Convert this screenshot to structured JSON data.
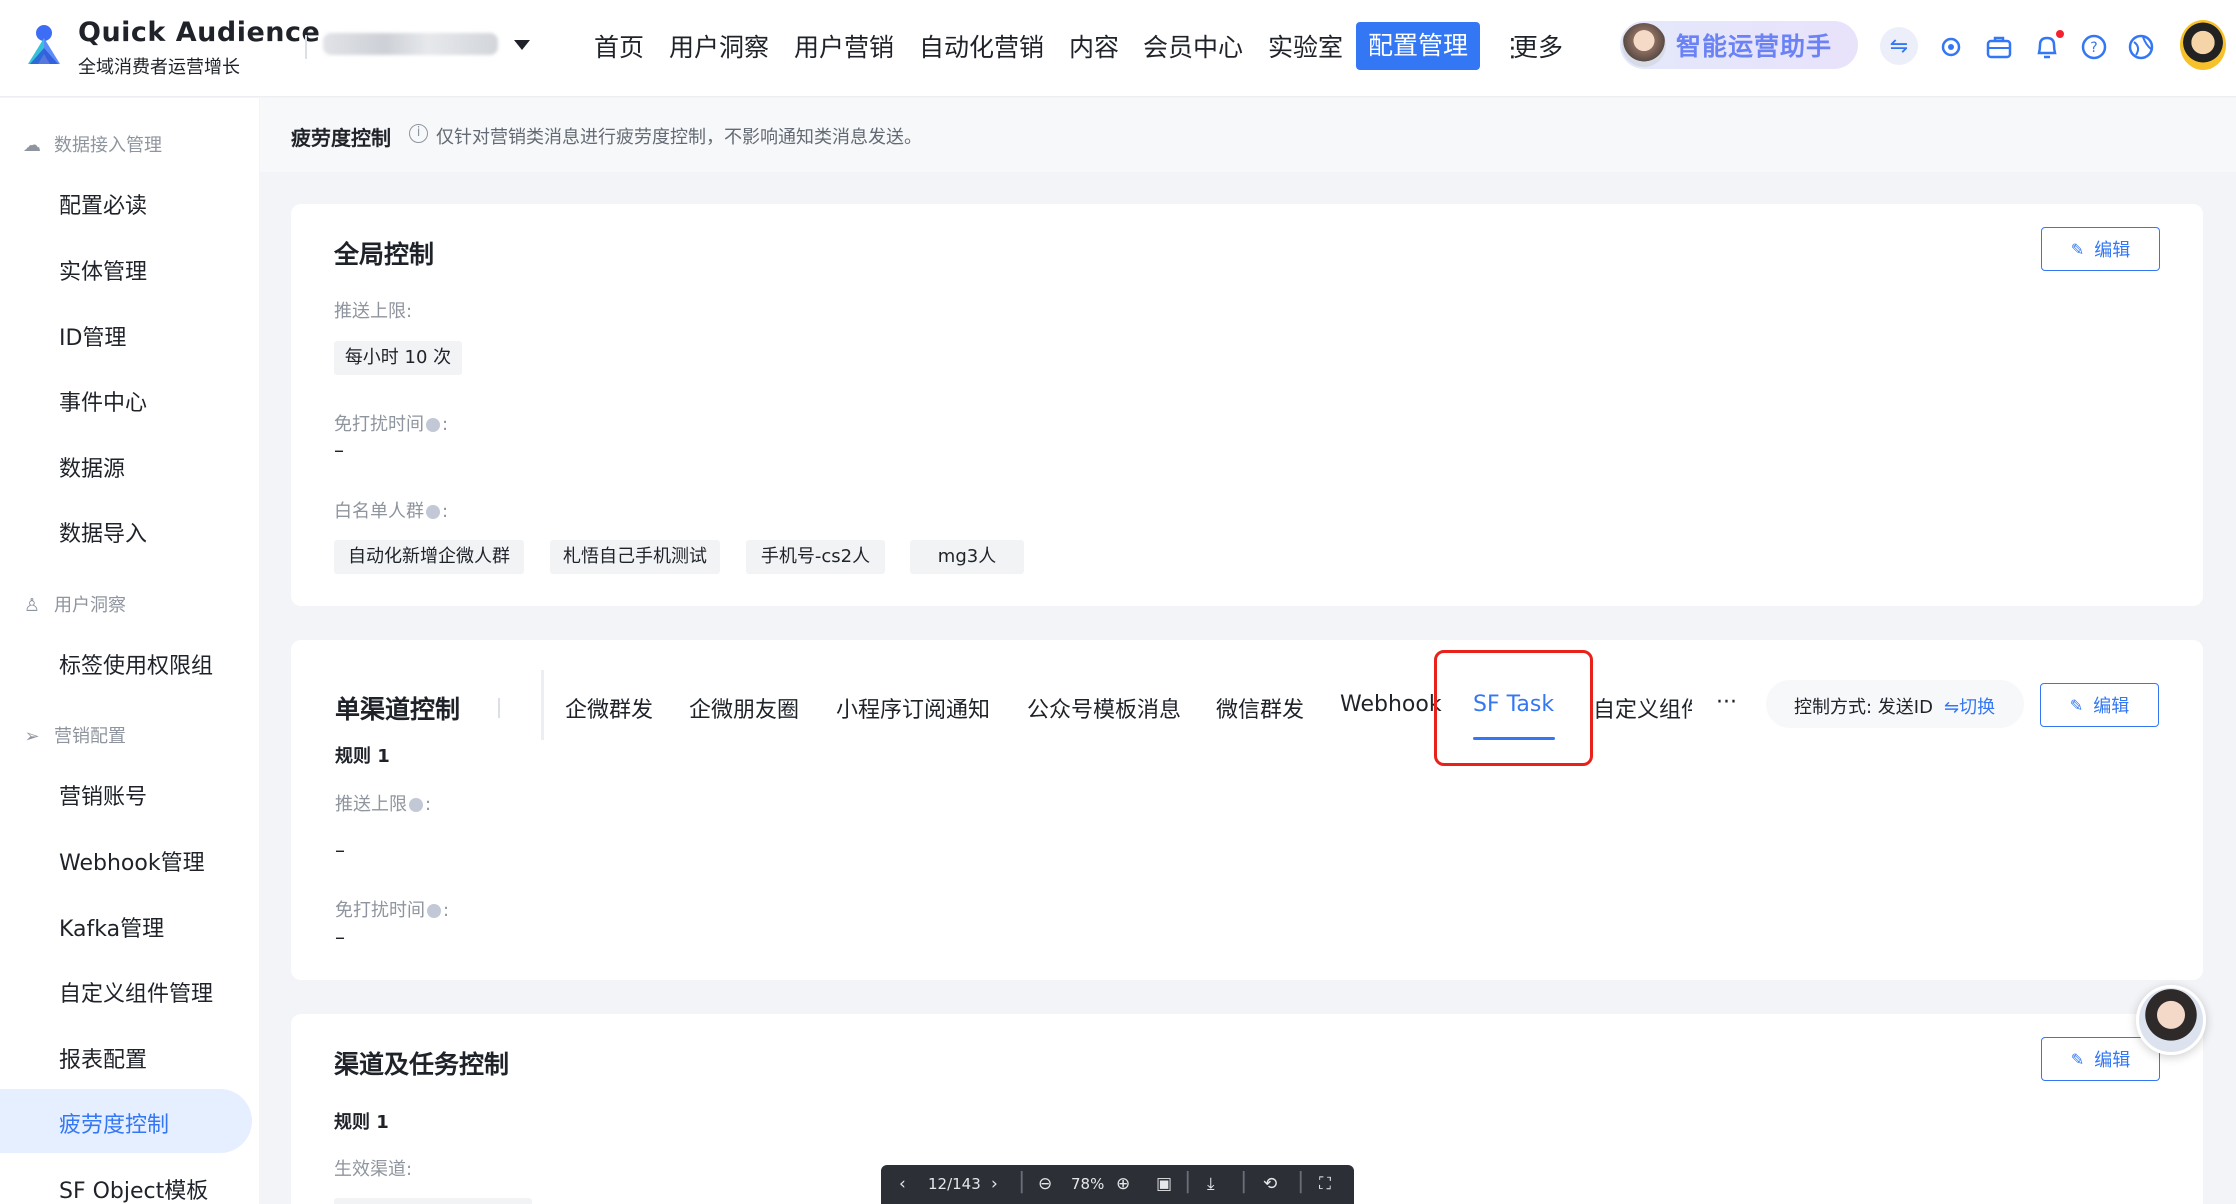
{
  "app": {
    "name": "Quick Audience",
    "subtitle": "全域消费者运营增长"
  },
  "topnav": {
    "items": [
      "首页",
      "用户洞察",
      "用户营销",
      "自动化营销",
      "内容",
      "会员中心",
      "实验室"
    ],
    "active": "配置管理",
    "more": "更多",
    "assistant": "智能运营助手",
    "accent": "#3477f5"
  },
  "sidebar": {
    "groups": [
      {
        "label": "数据接入管理",
        "icon": "cloud-icon"
      },
      {
        "label": "用户洞察",
        "icon": "user-icon"
      },
      {
        "label": "营销配置",
        "icon": "send-icon"
      }
    ],
    "items": [
      "配置必读",
      "实体管理",
      "ID管理",
      "事件中心",
      "数据源",
      "数据导入",
      "标签使用权限组",
      "营销账号",
      "Webhook管理",
      "Kafka管理",
      "自定义组件管理",
      "报表配置",
      "疲劳度控制",
      "SF Object模板"
    ],
    "active": "疲劳度控制"
  },
  "page": {
    "title": "疲劳度控制",
    "hint": "仅针对营销类消息进行疲劳度控制，不影响通知类消息发送。"
  },
  "global_card": {
    "title": "全局控制",
    "edit_label": "编辑",
    "push_limit_label": "推送上限",
    "push_limit_value": "每小时 10 次",
    "dnd_label": "免打扰时间",
    "dnd_value": "–",
    "whitelist_label": "白名单人群",
    "whitelist": [
      "自动化新增企微人群",
      "札悟自己手机测试",
      "手机号-cs2人",
      "mg3人"
    ]
  },
  "channel_card": {
    "title": "单渠道控制",
    "tabs": [
      "企微群发",
      "企微朋友圈",
      "小程序订阅通知",
      "公众号模板消息",
      "微信群发",
      "Webhook",
      "SF Task",
      "自定义组件"
    ],
    "active_tab": "SF Task",
    "more": "···",
    "control_mode": "控制方式: 发送ID",
    "switch_label": "切换",
    "edit_label": "编辑",
    "rule_title": "规则 1",
    "push_limit_label": "推送上限",
    "push_limit_value": "–",
    "dnd_label": "免打扰时间",
    "dnd_value": "–"
  },
  "task_card": {
    "title": "渠道及任务控制",
    "edit_label": "编辑",
    "rule_title": "规则 1",
    "effective_channel_label": "生效渠道"
  },
  "pdf_toolbar": {
    "page": "12/143",
    "zoom": "78%"
  }
}
